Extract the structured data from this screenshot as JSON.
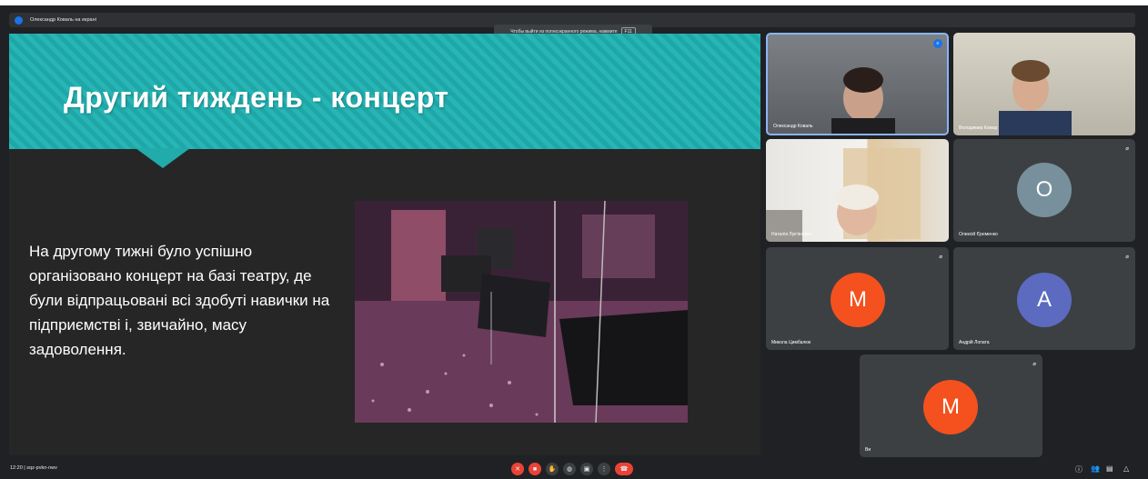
{
  "presenter": {
    "label": "Олександр Коваль на екрані"
  },
  "fullscreen_hint": {
    "text": "Чтобы выйти из полноэкранного режима, нажмите",
    "key": "F11"
  },
  "slide": {
    "title": "Другий тиждень - концерт",
    "body": "На другому тижні було успішно організовано концерт на базі театру, де були відпрацьовані всі здобуті навички на підприємстві і, звичайно, масу задоволення."
  },
  "participants": [
    {
      "name": "Олександр Коваль",
      "video": true,
      "speaking": true
    },
    {
      "name": "Володимир Комар",
      "video": true
    },
    {
      "name": "Наталія Лук'яненко",
      "video": true
    },
    {
      "name": "Олексій Єременко",
      "initial": "О",
      "color": "#78909c"
    },
    {
      "name": "Микола Цимбалюк",
      "initial": "М",
      "color": "#f4511e"
    },
    {
      "name": "Андрій Лопата",
      "initial": "А",
      "color": "#5c6bc0"
    },
    {
      "name": "Ви",
      "initial": "М",
      "color": "#f4511e"
    }
  ],
  "bottom": {
    "time": "12:20",
    "separator": "|",
    "meeting_code": "sqz-pvkn-nwv"
  },
  "colors": {
    "background": "#202124",
    "banner": "#27b5b5",
    "end_call": "#ea4335",
    "active_border": "#8ab4f8"
  },
  "icons": [
    "mic-off-icon",
    "camera-off-icon",
    "raise-hand-icon",
    "captions-icon",
    "present-icon",
    "more-icon",
    "end-call-icon",
    "info-icon",
    "people-icon",
    "chat-icon",
    "activities-icon"
  ]
}
